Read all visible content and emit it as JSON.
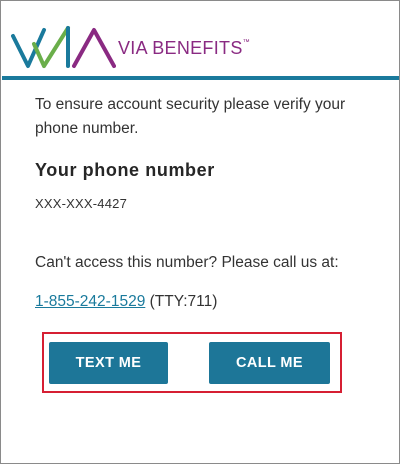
{
  "header": {
    "brand_name": "VIA BENEFITS",
    "trademark": "™",
    "accent_color": "#1a7a9c",
    "brand_color": "#8a2a82"
  },
  "verify": {
    "intro": "To ensure account security please verify your phone number.",
    "section_title": "Your phone number",
    "phone_masked": "XXX-XXX-4427",
    "help_text": "Can't access this number? Please call us at:",
    "support_phone": "1-855-242-1529",
    "tty": "(TTY:711)"
  },
  "actions": {
    "text_me_label": "TEXT ME",
    "call_me_label": "CALL ME",
    "button_color": "#1d7698",
    "highlight_color": "#d61f33"
  }
}
